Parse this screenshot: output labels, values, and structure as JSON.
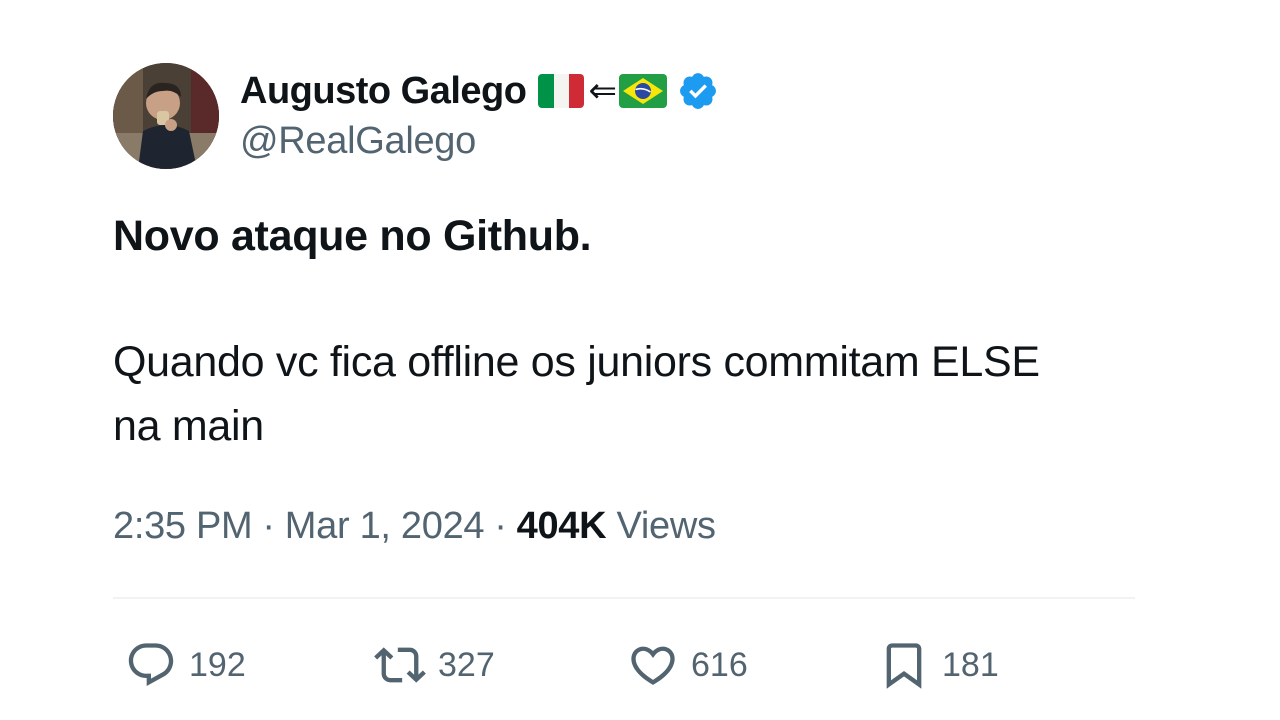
{
  "author": {
    "display_name": "Augusto Galego",
    "handle": "@RealGalego",
    "name_emoji": {
      "flag_left": "italy-flag",
      "arrow": "⇐",
      "flag_right": "brazil-flag"
    },
    "verified": true
  },
  "tweet": {
    "headline": "Novo ataque no Github.",
    "body_lines": [
      "Quando vc fica offline os juniors commitam ELSE",
      "na main"
    ]
  },
  "meta": {
    "time": "2:35 PM",
    "separator": "·",
    "date": "Mar 1, 2024",
    "views_count": "404K",
    "views_label": "Views"
  },
  "actions": {
    "replies": {
      "icon": "reply-icon",
      "count": "192"
    },
    "reposts": {
      "icon": "repost-icon",
      "count": "327"
    },
    "likes": {
      "icon": "heart-icon",
      "count": "616"
    },
    "bookmarks": {
      "icon": "bookmark-icon",
      "count": "181"
    }
  },
  "colors": {
    "text_primary": "#0f1419",
    "text_secondary": "#536471",
    "verified_blue": "#1d9bf0",
    "divider": "#eff3f4"
  }
}
